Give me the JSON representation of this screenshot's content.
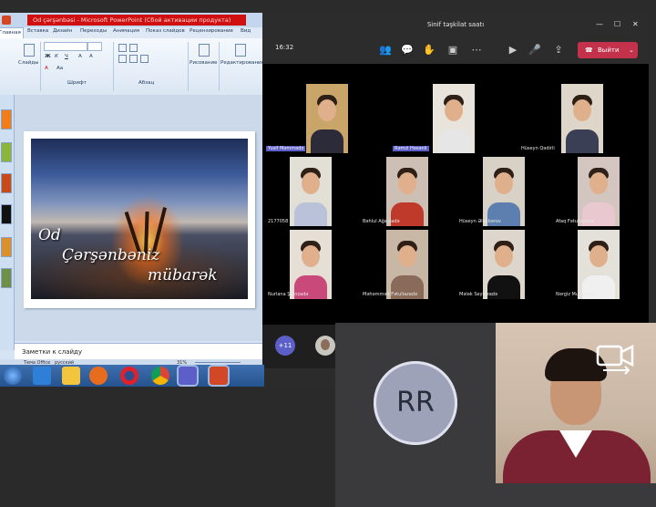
{
  "powerpoint": {
    "title": "Od çərşənbəsi - Microsoft PowerPoint (Сбой активации продукта)",
    "tabs": [
      "Главная",
      "Вставка",
      "Дизайн",
      "Переходы",
      "Анимация",
      "Показ слайдов",
      "Рецензирование",
      "Вид"
    ],
    "ribbon": {
      "slides_label": "Слайды",
      "font_group": "Шрифт",
      "paragraph_group": "Абзац",
      "drawing_label": "Рисование",
      "editing_label": "Редактирование"
    },
    "slide": {
      "line1": "Od",
      "line2": "Çərşənbəniz",
      "line3": "mübarək"
    },
    "notes_placeholder": "Заметки к слайду",
    "status": {
      "theme": "Тема Office",
      "language": "русский",
      "zoom": "31%"
    }
  },
  "teams": {
    "window_title": "Sinif təşkilat saatı",
    "time": "16:32",
    "leave_label": "Выйти",
    "more_count": "+11",
    "participants": [
      {
        "name": "Yusif Məmmədo",
        "highlight": true
      },
      {
        "name": "Rəmzi Həsənli",
        "highlight": true
      },
      {
        "name": "Hüseyn Qədirli",
        "highlight": false
      },
      {
        "name": "2177058",
        "highlight": false
      },
      {
        "name": "Bəhlul Ağa-zadə",
        "highlight": false
      },
      {
        "name": "Hüseyn Ələkbərov",
        "highlight": false
      },
      {
        "name": "Afaq Fətullazadə",
        "highlight": false
      },
      {
        "name": "Nurlana Şirinzadə",
        "highlight": false
      },
      {
        "name": "Məhəmməd Fətullazadə",
        "highlight": false
      },
      {
        "name": "Mələk Seyidzadə",
        "highlight": false
      },
      {
        "name": "Nərgiz Musazadə",
        "highlight": false
      }
    ]
  },
  "call": {
    "caller_initials": "RR",
    "camera_switch_icon": "camera-switch-icon"
  },
  "taskbar": {
    "icons": [
      "windows-start-icon",
      "ie-icon",
      "explorer-icon",
      "media-player-icon",
      "opera-icon",
      "chrome-icon",
      "teams-icon",
      "powerpoint-icon"
    ]
  }
}
